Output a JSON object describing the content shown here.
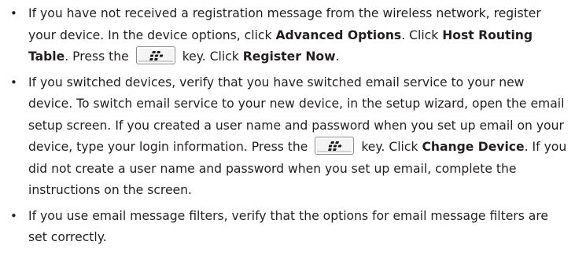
{
  "bullet_char": "•",
  "icons": {
    "bb_key": "blackberry-key-icon"
  },
  "items": [
    {
      "t1": "If you have not received a registration message from the wireless network, register your device. In the device options, click ",
      "b1": "Advanced Options",
      "t2": ". Click ",
      "b2": "Host Routing Table",
      "t3": ". Press the",
      "t4": "key. Click ",
      "b3": "Register Now",
      "t5": "."
    },
    {
      "t1": "If you switched devices, verify that you have switched email service to your new device. To switch email service to your new device, in the setup wizard, open the email setup screen. If you created a user name and password when you set up email on your device, type your login information. Press the",
      "t2": "key. Click ",
      "b1": "Change Device",
      "t3": ". If you did not create a user name and password when you set up email, complete the instructions on the screen."
    },
    {
      "t1": "If you use email message filters, verify that the options for email message filters are set correctly."
    }
  ]
}
